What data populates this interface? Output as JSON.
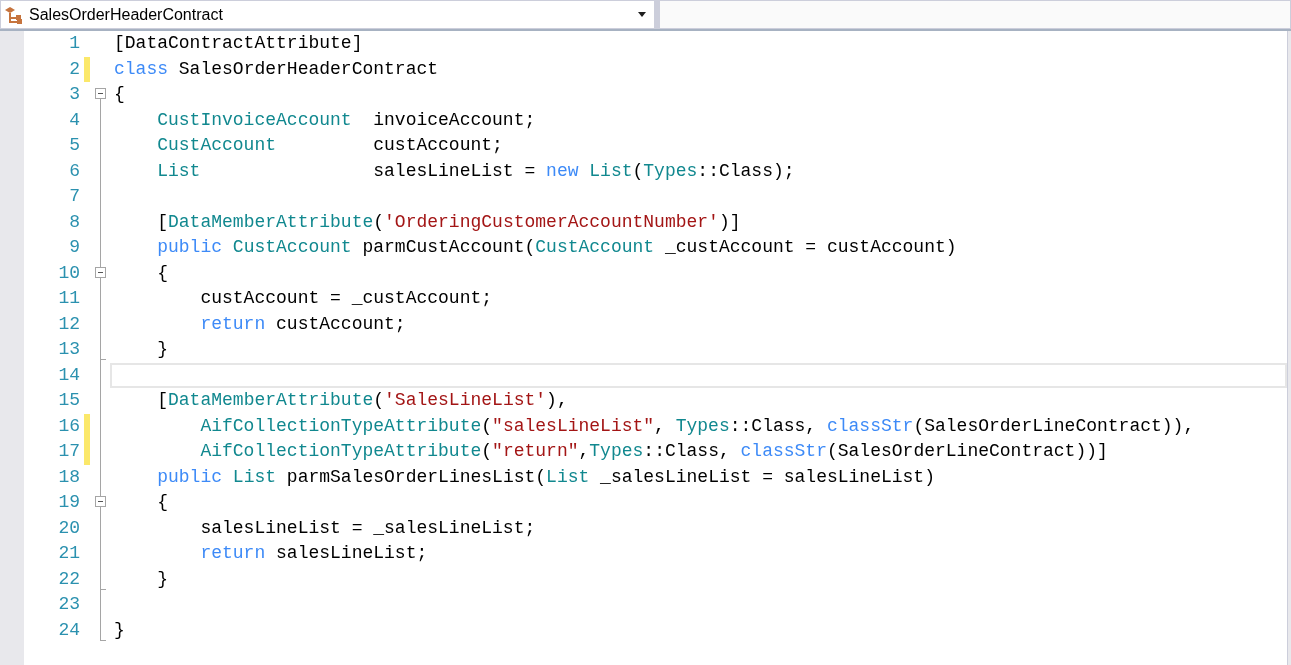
{
  "navigation_bar": {
    "type_dropdown": {
      "value": "SalesOrderHeaderContract"
    }
  },
  "lines": [
    {
      "number": "1",
      "changed": false,
      "collapsible": false,
      "block_end": false,
      "selected": false,
      "tokens": [
        {
          "kind": "plain",
          "t": "[DataContractAttribute]"
        }
      ]
    },
    {
      "number": "2",
      "changed": true,
      "collapsible": false,
      "block_end": false,
      "selected": false,
      "tokens": [
        {
          "kind": "keyword",
          "t": "class"
        },
        {
          "kind": "plain",
          "t": " SalesOrderHeaderContract"
        }
      ]
    },
    {
      "number": "3",
      "changed": false,
      "collapsible": true,
      "block_end": false,
      "selected": false,
      "tokens": [
        {
          "kind": "plain",
          "t": "{"
        }
      ]
    },
    {
      "number": "4",
      "changed": false,
      "collapsible": false,
      "block_end": false,
      "selected": false,
      "tokens": [
        {
          "kind": "type",
          "t": "    CustInvoiceAccount"
        },
        {
          "kind": "plain",
          "t": "  invoiceAccount;"
        }
      ]
    },
    {
      "number": "5",
      "changed": false,
      "collapsible": false,
      "block_end": false,
      "selected": false,
      "tokens": [
        {
          "kind": "type",
          "t": "    CustAccount"
        },
        {
          "kind": "plain",
          "t": "         custAccount;"
        }
      ]
    },
    {
      "number": "6",
      "changed": false,
      "collapsible": false,
      "block_end": false,
      "selected": false,
      "tokens": [
        {
          "kind": "type",
          "t": "    List"
        },
        {
          "kind": "plain",
          "t": "                salesLineList = "
        },
        {
          "kind": "keyword",
          "t": "new"
        },
        {
          "kind": "type",
          "t": " List"
        },
        {
          "kind": "plain",
          "t": "("
        },
        {
          "kind": "type",
          "t": "Types"
        },
        {
          "kind": "plain",
          "t": "::Class);"
        }
      ]
    },
    {
      "number": "7",
      "changed": false,
      "collapsible": false,
      "block_end": false,
      "selected": false
    },
    {
      "number": "8",
      "changed": false,
      "collapsible": false,
      "block_end": false,
      "selected": false,
      "tokens": [
        {
          "kind": "plain",
          "t": "    ["
        },
        {
          "kind": "type",
          "t": "DataMemberAttribute"
        },
        {
          "kind": "plain",
          "t": "("
        },
        {
          "kind": "string",
          "t": "'OrderingCustomerAccountNumber'"
        },
        {
          "kind": "plain",
          "t": ")]"
        }
      ]
    },
    {
      "number": "9",
      "changed": false,
      "collapsible": false,
      "block_end": false,
      "selected": false,
      "tokens": [
        {
          "kind": "keyword",
          "t": "    public"
        },
        {
          "kind": "type",
          "t": " CustAccount"
        },
        {
          "kind": "plain",
          "t": " parmCustAccount("
        },
        {
          "kind": "type",
          "t": "CustAccount"
        },
        {
          "kind": "plain",
          "t": " _custAccount = custAccount)"
        }
      ]
    },
    {
      "number": "10",
      "changed": false,
      "collapsible": true,
      "block_end": false,
      "selected": false,
      "tokens": [
        {
          "kind": "plain",
          "t": "    {"
        }
      ]
    },
    {
      "number": "11",
      "changed": false,
      "collapsible": false,
      "block_end": false,
      "selected": false,
      "tokens": [
        {
          "kind": "plain",
          "t": "        custAccount = _custAccount;"
        }
      ]
    },
    {
      "number": "12",
      "changed": false,
      "collapsible": false,
      "block_end": false,
      "selected": false,
      "tokens": [
        {
          "kind": "keyword",
          "t": "        return"
        },
        {
          "kind": "plain",
          "t": " custAccount;"
        }
      ]
    },
    {
      "number": "13",
      "changed": false,
      "collapsible": false,
      "block_end": true,
      "selected": false,
      "tokens": [
        {
          "kind": "plain",
          "t": "    }"
        }
      ]
    },
    {
      "number": "14",
      "changed": false,
      "collapsible": false,
      "block_end": false,
      "selected": true
    },
    {
      "number": "15",
      "changed": false,
      "collapsible": false,
      "block_end": false,
      "selected": false,
      "tokens": [
        {
          "kind": "plain",
          "t": "    ["
        },
        {
          "kind": "type",
          "t": "DataMemberAttribute"
        },
        {
          "kind": "plain",
          "t": "("
        },
        {
          "kind": "string",
          "t": "'SalesLineList'"
        },
        {
          "kind": "plain",
          "t": "),"
        }
      ]
    },
    {
      "number": "16",
      "changed": true,
      "collapsible": false,
      "block_end": false,
      "selected": false,
      "tokens": [
        {
          "kind": "type",
          "t": "        AifCollectionTypeAttribute"
        },
        {
          "kind": "plain",
          "t": "("
        },
        {
          "kind": "string",
          "t": "\"salesLineList\""
        },
        {
          "kind": "plain",
          "t": ", "
        },
        {
          "kind": "type",
          "t": "Types"
        },
        {
          "kind": "plain",
          "t": "::Class, "
        },
        {
          "kind": "keyword",
          "t": "classStr"
        },
        {
          "kind": "plain",
          "t": "(SalesOrderLineContract)),"
        }
      ]
    },
    {
      "number": "17",
      "changed": true,
      "collapsible": false,
      "block_end": false,
      "selected": false,
      "tokens": [
        {
          "kind": "type",
          "t": "        AifCollectionTypeAttribute"
        },
        {
          "kind": "plain",
          "t": "("
        },
        {
          "kind": "string",
          "t": "\"return\""
        },
        {
          "kind": "plain",
          "t": ","
        },
        {
          "kind": "type",
          "t": "Types"
        },
        {
          "kind": "plain",
          "t": "::Class, "
        },
        {
          "kind": "keyword",
          "t": "classStr"
        },
        {
          "kind": "plain",
          "t": "(SalesOrderLineContract))]"
        }
      ]
    },
    {
      "number": "18",
      "changed": false,
      "collapsible": false,
      "block_end": false,
      "selected": false,
      "tokens": [
        {
          "kind": "keyword",
          "t": "    public"
        },
        {
          "kind": "type",
          "t": " List"
        },
        {
          "kind": "plain",
          "t": " parmSalesOrderLinesList("
        },
        {
          "kind": "type",
          "t": "List"
        },
        {
          "kind": "plain",
          "t": " _salesLineList = salesLineList)"
        }
      ]
    },
    {
      "number": "19",
      "changed": false,
      "collapsible": true,
      "block_end": false,
      "selected": false,
      "tokens": [
        {
          "kind": "plain",
          "t": "    {"
        }
      ]
    },
    {
      "number": "20",
      "changed": false,
      "collapsible": false,
      "block_end": false,
      "selected": false,
      "tokens": [
        {
          "kind": "plain",
          "t": "        salesLineList = _salesLineList;"
        }
      ]
    },
    {
      "number": "21",
      "changed": false,
      "collapsible": false,
      "block_end": false,
      "selected": false,
      "tokens": [
        {
          "kind": "keyword",
          "t": "        return"
        },
        {
          "kind": "plain",
          "t": " salesLineList;"
        }
      ]
    },
    {
      "number": "22",
      "changed": false,
      "collapsible": false,
      "block_end": true,
      "selected": false,
      "tokens": [
        {
          "kind": "plain",
          "t": "    }"
        }
      ]
    },
    {
      "number": "23",
      "changed": false,
      "collapsible": false,
      "block_end": false,
      "selected": false
    },
    {
      "number": "24",
      "changed": false,
      "collapsible": false,
      "block_end": true,
      "selected": false,
      "tokens": [
        {
          "kind": "plain",
          "t": "}"
        }
      ]
    }
  ]
}
